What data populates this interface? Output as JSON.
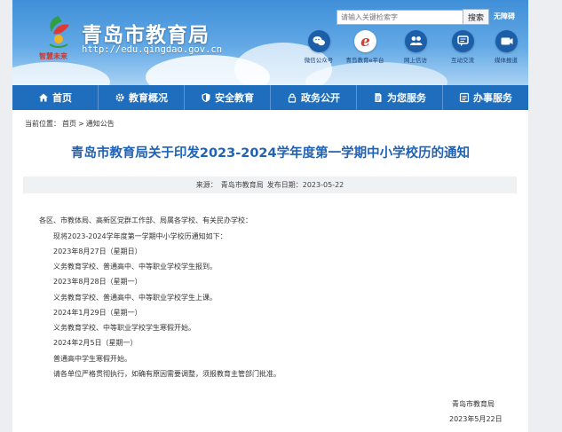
{
  "header": {
    "site_title": "青岛市教育局",
    "site_url": "http://edu.qingdao.gov.cn",
    "logo_slogan": "智慧未来",
    "search": {
      "placeholder": "请输入关键检索字",
      "button_label": "搜索",
      "advanced_label": "无障碍"
    },
    "quick_links": [
      {
        "label": "微信公众号",
        "icon": "wechat-icon"
      },
      {
        "label": "青岛教育e平台",
        "icon": "e-platform-icon"
      },
      {
        "label": "网上信访",
        "icon": "people-icon"
      },
      {
        "label": "互动交流",
        "icon": "chat-icon"
      },
      {
        "label": "媒体报道",
        "icon": "video-icon"
      }
    ]
  },
  "nav": {
    "items": [
      {
        "label": "首页",
        "icon": "home-icon"
      },
      {
        "label": "教育概况",
        "icon": "gear-icon"
      },
      {
        "label": "安全教育",
        "icon": "shield-icon"
      },
      {
        "label": "政务公开",
        "icon": "lock-icon"
      },
      {
        "label": "为您服务",
        "icon": "document-icon"
      },
      {
        "label": "办事服务",
        "icon": "list-icon"
      }
    ]
  },
  "breadcrumb": {
    "prefix": "当前位置：",
    "home": "首页",
    "separator": ">",
    "current": "通知公告"
  },
  "article": {
    "title": "青岛市教育局关于印发2023-2024学年度第一学期中小学校历的通知",
    "source_label": "来源：",
    "source": "青岛市教育局",
    "date_label": "发布日期：",
    "date": "2023-05-22",
    "salutation": "各区、市教体局、高新区党群工作部、局属各学校、有关民办学校：",
    "paragraphs": [
      "现将2023-2024学年度第一学期中小学校历通知如下：",
      "2023年8月27日（星期日）",
      "义务教育学校、普通高中、中等职业学校学生报到。",
      "2023年8月28日（星期一）",
      "义务教育学校、普通高中、中等职业学校学生上课。",
      "2024年1月29日（星期一）",
      "义务教育学校、中等职业学校学生寒假开始。",
      "2024年2月5日（星期一）",
      "普通高中学生寒假开始。",
      "请各单位严格贯彻执行，如确有原因需要调整，须报教育主管部门批准。"
    ],
    "signature_org": "青岛市教育局",
    "signature_date": "2023年5月22日"
  },
  "colors": {
    "nav_bg": "#1f6dbd",
    "title_blue": "#1f63b6",
    "icon_circle": "#1c5fa8"
  }
}
